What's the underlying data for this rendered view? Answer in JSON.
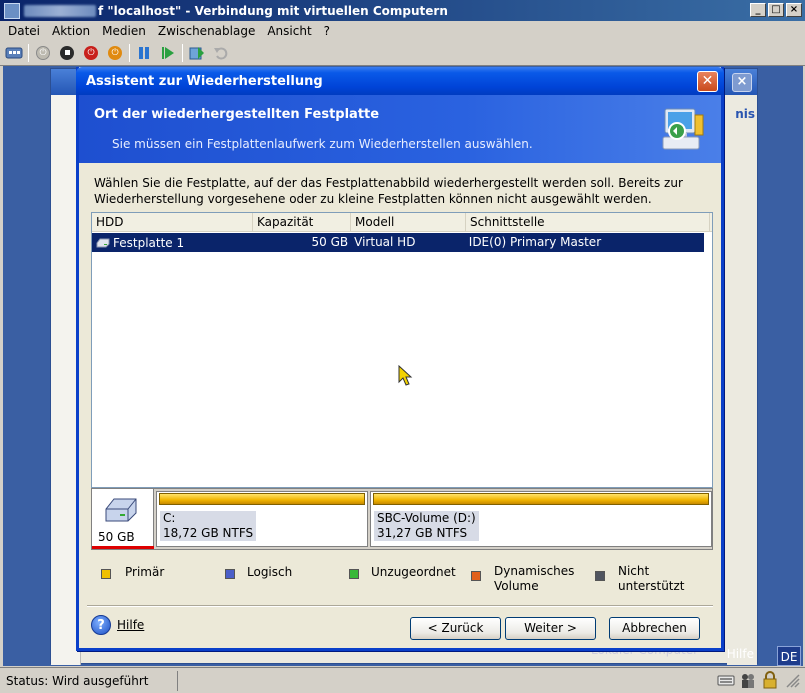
{
  "vm_window": {
    "title": "f \"localhost\" - Verbindung mit virtuellen Computern",
    "menu": [
      "Datei",
      "Aktion",
      "Medien",
      "Zwischenablage",
      "Ansicht",
      "?"
    ],
    "toolbar_icons": [
      "ctrl-alt-del-icon",
      "power-on-icon",
      "stop-icon",
      "shutdown-icon",
      "reset-icon",
      "pause-icon",
      "resume-icon",
      "snapshot-icon",
      "revert-icon"
    ]
  },
  "background_app": {
    "brand": "nis",
    "help": "Hilfe",
    "bottom_text": "Lokaler Computer",
    "lang": "DE"
  },
  "wizard": {
    "title": "Assistent zur Wiederherstellung",
    "header_title": "Ort der wiederhergestellten Festplatte",
    "header_subtitle": "Sie müssen ein Festplattenlaufwerk zum Wiederherstellen auswählen.",
    "description": "Wählen Sie die Festplatte, auf der das Festplattenabbild wiederhergestellt werden soll. Bereits zur Wiederherstellung vorgesehene oder zu kleine Festplatten können nicht ausgewählt werden.",
    "columns": [
      "HDD",
      "Kapazität",
      "Modell",
      "Schnittstelle"
    ],
    "rows": [
      {
        "hdd": "Festplatte 1",
        "capacity": "50 GB",
        "model": "Virtual HD",
        "interface": "IDE(0) Primary Master"
      }
    ],
    "disk_map": {
      "disk_size": "50 GB",
      "partitions": [
        {
          "name": "C:",
          "size": "18,72 GB  NTFS"
        },
        {
          "name": "SBC-Volume (D:)",
          "size": "31,27 GB  NTFS"
        }
      ]
    },
    "legend": {
      "primary": "Primär",
      "logical": "Logisch",
      "unallocated": "Unzugeordnet",
      "dynamic_1": "Dynamisches",
      "dynamic_2": "Volume",
      "unsupported_1": "Nicht",
      "unsupported_2": "unterstützt",
      "colors": {
        "primary": "#f0c000",
        "logical": "#4a5ec8",
        "unallocated": "#38b838",
        "dynamic": "#e0601c",
        "unsupported": "#505560"
      }
    },
    "buttons": {
      "help": "Hilfe",
      "back": "< Zurück",
      "next": "Weiter >",
      "cancel": "Abbrechen"
    }
  },
  "statusbar": {
    "text": "Status: Wird ausgeführt"
  }
}
